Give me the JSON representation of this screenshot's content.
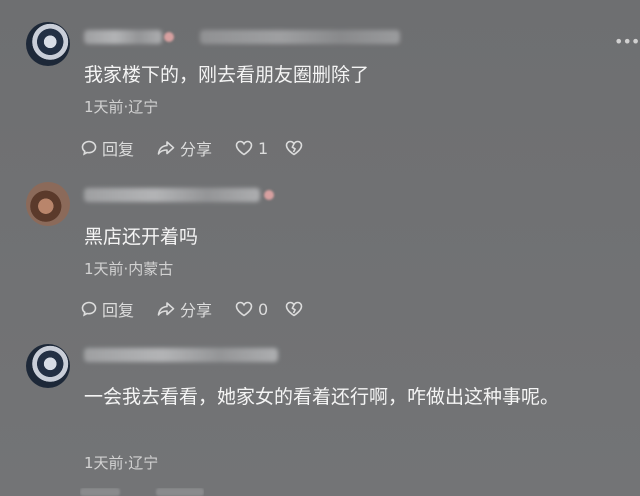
{
  "comments": [
    {
      "text": "我家楼下的，刚去看朋友圈删除了",
      "meta": "1天前·辽宁",
      "reply_label": "回复",
      "share_label": "分享",
      "like_count": "1"
    },
    {
      "text": "黑店还开着吗",
      "meta": "1天前·内蒙古",
      "reply_label": "回复",
      "share_label": "分享",
      "like_count": "0"
    },
    {
      "text": "一会我去看看，她家女的看着还行啊，咋做出这种事呢。",
      "meta": "1天前·辽宁",
      "reply_label": "回复",
      "share_label": "分享"
    }
  ],
  "icons": {
    "reply": "comment-bubble-icon",
    "share": "share-arrow-icon",
    "like": "heart-icon",
    "dislike": "broken-heart-icon",
    "menu": "more-dots-icon"
  }
}
